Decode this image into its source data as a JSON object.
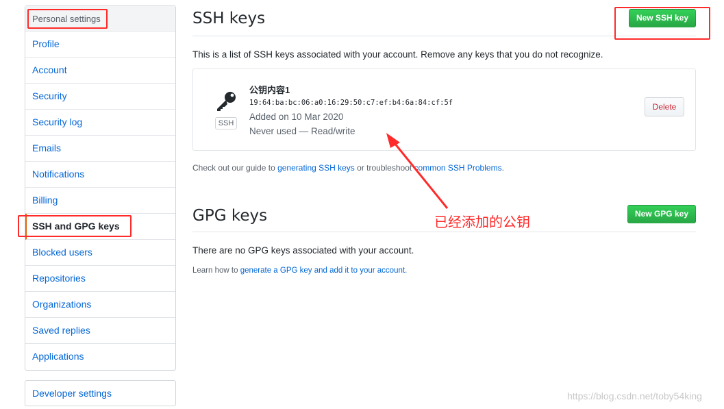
{
  "sidebar": {
    "header": "Personal settings",
    "items": [
      {
        "label": "Profile"
      },
      {
        "label": "Account"
      },
      {
        "label": "Security"
      },
      {
        "label": "Security log"
      },
      {
        "label": "Emails"
      },
      {
        "label": "Notifications"
      },
      {
        "label": "Billing"
      },
      {
        "label": "SSH and GPG keys",
        "selected": true
      },
      {
        "label": "Blocked users"
      },
      {
        "label": "Repositories"
      },
      {
        "label": "Organizations"
      },
      {
        "label": "Saved replies"
      },
      {
        "label": "Applications"
      }
    ],
    "developer_settings": "Developer settings"
  },
  "ssh": {
    "title": "SSH keys",
    "new_button": "New SSH key",
    "intro": "This is a list of SSH keys associated with your account. Remove any keys that you do not recognize.",
    "key": {
      "name": "公钥内容1",
      "fingerprint": "19:64:ba:bc:06:a0:16:29:50:c7:ef:b4:6a:84:cf:5f",
      "added": "Added on 10 Mar 2020",
      "usage": "Never used — Read/write",
      "badge": "SSH",
      "delete_label": "Delete"
    },
    "guide_prefix": "Check out our guide to ",
    "guide_link1": "generating SSH keys",
    "guide_mid": " or troubleshoot ",
    "guide_link2": "common SSH Problems",
    "guide_suffix": "."
  },
  "gpg": {
    "title": "GPG keys",
    "new_button": "New GPG key",
    "empty": "There are no GPG keys associated with your account.",
    "learn_prefix": "Learn how to ",
    "learn_link": "generate a GPG key and add it to your account",
    "learn_suffix": "."
  },
  "annotation": {
    "text": "已经添加的公钥",
    "color": "#ff2a2a"
  },
  "watermark": "https://blog.csdn.net/toby54king",
  "colors": {
    "link": "#0366d6",
    "green_button": "#28a745",
    "delete_text": "#cb2431"
  }
}
